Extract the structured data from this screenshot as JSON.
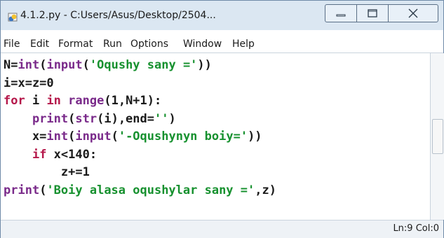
{
  "window": {
    "title": "4.1.2.py - C:Users/Asus/Desktop/2504...",
    "icon": "python-file-icon",
    "controls": [
      "minimize-icon",
      "maximize-icon",
      "close-icon"
    ]
  },
  "menubar": {
    "items": [
      "File",
      "Edit",
      "Format",
      "Run",
      "Options",
      "Window",
      "Help"
    ]
  },
  "code": {
    "lines": [
      [
        [
          "p",
          "N="
        ],
        [
          "b",
          "int"
        ],
        [
          "p",
          "("
        ],
        [
          "b",
          "input"
        ],
        [
          "p",
          "("
        ],
        [
          "s",
          "'Oqushy sany ='"
        ],
        [
          "p",
          "))"
        ]
      ],
      [
        [
          "p",
          "i=x=z=0"
        ]
      ],
      [
        [
          "k",
          "for"
        ],
        [
          "p",
          " i "
        ],
        [
          "k",
          "in"
        ],
        [
          "p",
          " "
        ],
        [
          "b",
          "range"
        ],
        [
          "p",
          "(1,N+1):"
        ]
      ],
      [
        [
          "p",
          "    "
        ],
        [
          "b",
          "print"
        ],
        [
          "p",
          "("
        ],
        [
          "b",
          "str"
        ],
        [
          "p",
          "(i),end="
        ],
        [
          "s",
          "''"
        ],
        [
          "p",
          ")"
        ]
      ],
      [
        [
          "p",
          "    x="
        ],
        [
          "b",
          "int"
        ],
        [
          "p",
          "("
        ],
        [
          "b",
          "input"
        ],
        [
          "p",
          "("
        ],
        [
          "s",
          "'-Oqushynyn boiy='"
        ],
        [
          "p",
          "))"
        ]
      ],
      [
        [
          "p",
          "    "
        ],
        [
          "k",
          "if"
        ],
        [
          "p",
          " x<140:"
        ]
      ],
      [
        [
          "p",
          "        z+=1"
        ]
      ],
      [
        [
          "b",
          "print"
        ],
        [
          "p",
          "("
        ],
        [
          "s",
          "'Boiy alasa oqushylar sany ='"
        ],
        [
          "p",
          ",z)"
        ]
      ]
    ]
  },
  "status": {
    "text": "Ln:9 Col:0"
  }
}
